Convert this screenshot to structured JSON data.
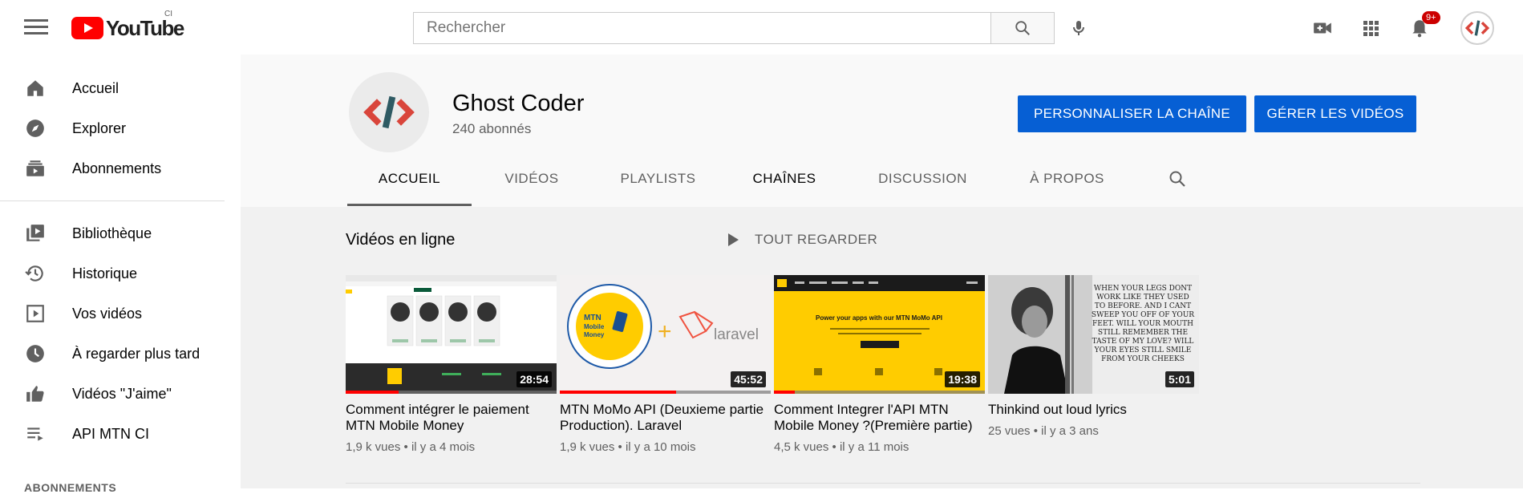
{
  "header": {
    "logo_text": "YouTube",
    "logo_sup": "CI",
    "search_placeholder": "Rechercher",
    "notification_count": "9+"
  },
  "sidebar": {
    "items": [
      {
        "label": "Accueil",
        "icon": "home-icon"
      },
      {
        "label": "Explorer",
        "icon": "compass-icon"
      },
      {
        "label": "Abonnements",
        "icon": "subscriptions-icon"
      },
      {
        "label": "Bibliothèque",
        "icon": "library-icon"
      },
      {
        "label": "Historique",
        "icon": "history-icon"
      },
      {
        "label": "Vos vidéos",
        "icon": "your-videos-icon"
      },
      {
        "label": "À regarder plus tard",
        "icon": "clock-icon"
      },
      {
        "label": "Vidéos \"J'aime\"",
        "icon": "thumbs-up-icon"
      },
      {
        "label": "API MTN CI",
        "icon": "playlist-icon"
      }
    ],
    "section_title": "ABONNEMENTS"
  },
  "channel": {
    "name": "Ghost Coder",
    "subscribers": "240 abonnés",
    "customize_label": "PERSONNALISER LA CHAÎNE",
    "manage_label": "GÉRER LES VIDÉOS",
    "tabs": [
      "ACCUEIL",
      "VIDÉOS",
      "PLAYLISTS",
      "CHAÎNES",
      "DISCUSSION",
      "À PROPOS"
    ]
  },
  "shelf": {
    "title": "Vidéos en ligne",
    "play_all_label": "TOUT REGARDER",
    "videos": [
      {
        "title": "Comment intégrer le paiement MTN Mobile Money",
        "meta": "1,9 k vues • il y a 4 mois",
        "duration": "28:54",
        "progress": 0.25
      },
      {
        "title": "MTN MoMo API (Deuxieme partie Production). Laravel",
        "meta": "1,9 k vues • il y a 10 mois",
        "duration": "45:52",
        "progress": 0.55
      },
      {
        "title": "Comment Integrer l'API MTN Mobile Money ?(Première partie)",
        "meta": "4,5 k vues • il y a 11 mois",
        "duration": "19:38",
        "progress": 0.1
      },
      {
        "title": "Thinkind out loud lyrics",
        "meta": "25 vues • il y a 3 ans",
        "duration": "5:01",
        "progress": 0
      }
    ]
  },
  "thumb_text": {
    "momo_line1": "MTN",
    "momo_line2": "Mobile",
    "momo_line3": "Money",
    "laravel": "laravel",
    "banner_title": "Power your apps with our MTN MoMo API",
    "lyrics": "WHEN YOUR LEGS DONT WORK LIKE THEY USED TO BEFORE. AND I CANT SWEEP YOU OFF OF YOUR FEET. WILL YOUR MOUTH STILL REMEMBER THE TASTE OF MY LOVE? WILL YOUR EYES STILL SMILE FROM YOUR CHEEKS"
  },
  "colors": {
    "brand_red": "#ff0000",
    "button_blue": "#065fd4",
    "header_bg": "#f9f9f9",
    "content_bg": "#f1f1f1"
  }
}
